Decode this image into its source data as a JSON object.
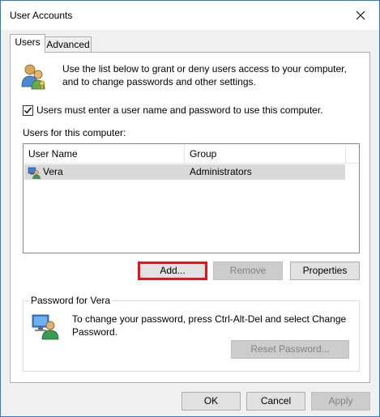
{
  "window": {
    "title": "User Accounts"
  },
  "tabs": [
    {
      "label": "Users",
      "selected": true
    },
    {
      "label": "Advanced",
      "selected": false
    }
  ],
  "users_tab": {
    "intro": "Use the list below to grant or deny users access to your computer, and to change passwords and other settings.",
    "require_login": {
      "label": "Users must enter a user name and password to use this computer.",
      "checked": true
    },
    "list_label": "Users for this computer:",
    "columns": [
      "User Name",
      "Group"
    ],
    "rows": [
      {
        "name": "Vera",
        "group": "Administrators",
        "selected": true
      }
    ],
    "buttons": {
      "add": "Add...",
      "remove": "Remove",
      "properties": "Properties"
    },
    "password_group": {
      "title": "Password for Vera",
      "text": "To change your password, press Ctrl-Alt-Del and select Change Password.",
      "reset": "Reset Password..."
    }
  },
  "footer": {
    "ok": "OK",
    "cancel": "Cancel",
    "apply": "Apply"
  },
  "colors": {
    "accent_border": "#2b79d0",
    "highlight_red": "#e8111e"
  }
}
